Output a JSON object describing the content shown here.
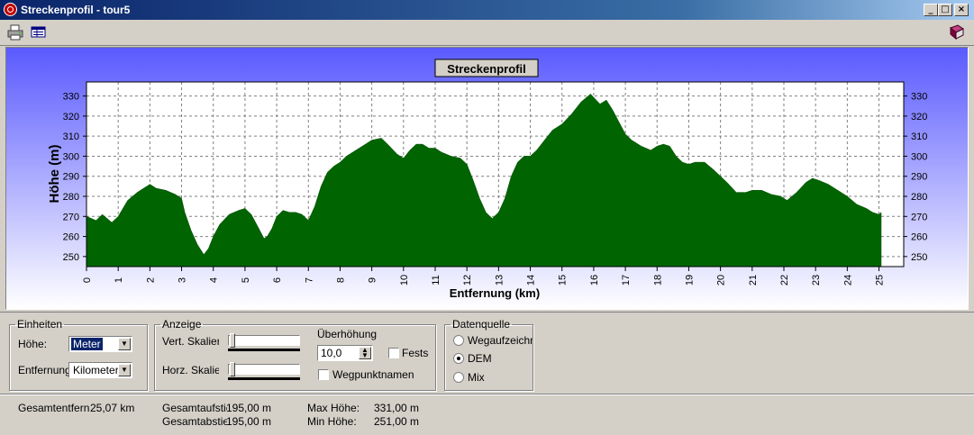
{
  "window": {
    "title": "Streckenprofil - tour5",
    "controls": {
      "minimize": "_",
      "maximize": "□",
      "close": "×"
    }
  },
  "toolbar": {
    "icons": [
      "print-icon",
      "table-icon",
      "help-book-icon"
    ]
  },
  "chart_data": {
    "type": "area",
    "title": "Streckenprofil",
    "xlabel": "Entfernung (km)",
    "ylabel": "Höhe (m)",
    "xlim": [
      0,
      25.07
    ],
    "ylim": [
      245,
      337
    ],
    "x_ticks": [
      0,
      1,
      2,
      3,
      4,
      5,
      6,
      7,
      8,
      9,
      10,
      11,
      12,
      13,
      14,
      15,
      16,
      17,
      18,
      19,
      20,
      21,
      22,
      23,
      24,
      25
    ],
    "y_ticks": [
      250,
      260,
      270,
      280,
      290,
      300,
      310,
      320,
      330
    ],
    "grid": true,
    "fill_color": "#006400",
    "background_gradient": [
      "#5a5aff",
      "#ffffff"
    ],
    "series": [
      {
        "x": [
          0,
          0.3,
          0.5,
          0.8,
          1.0,
          1.3,
          1.6,
          1.9,
          2.0,
          2.2,
          2.5,
          2.8,
          3.0,
          3.1,
          3.3,
          3.5,
          3.7,
          3.85,
          4.0,
          4.2,
          4.5,
          4.8,
          5.0,
          5.2,
          5.4,
          5.6,
          5.7,
          5.85,
          6.0,
          6.2,
          6.4,
          6.6,
          6.8,
          7.0,
          7.2,
          7.4,
          7.6,
          7.8,
          8.0,
          8.2,
          8.5,
          8.8,
          9.0,
          9.3,
          9.5,
          9.8,
          10.0,
          10.2,
          10.4,
          10.6,
          10.8,
          11.0,
          11.2,
          11.5,
          11.8,
          12.0,
          12.2,
          12.4,
          12.6,
          12.8,
          13.0,
          13.2,
          13.4,
          13.6,
          13.8,
          14.0,
          14.2,
          14.5,
          14.7,
          15.0,
          15.3,
          15.6,
          15.9,
          16.2,
          16.4,
          16.6,
          16.8,
          17.0,
          17.2,
          17.5,
          17.8,
          18.0,
          18.2,
          18.4,
          18.6,
          18.8,
          19.0,
          19.2,
          19.5,
          19.8,
          20.0,
          20.2,
          20.5,
          20.8,
          21.0,
          21.3,
          21.6,
          21.9,
          22.1,
          22.4,
          22.7,
          22.9,
          23.1,
          23.4,
          23.7,
          24.0,
          24.3,
          24.6,
          24.8,
          25.0,
          25.07
        ],
        "y": [
          270,
          268,
          271,
          267,
          270,
          278,
          282,
          285,
          286,
          284,
          283,
          281,
          279,
          272,
          263,
          256,
          251,
          254,
          260,
          266,
          271,
          273,
          274,
          271,
          265,
          259,
          260,
          264,
          270,
          273,
          272,
          272,
          271,
          268,
          275,
          285,
          292,
          295,
          297,
          300,
          303,
          306,
          308,
          309,
          306,
          301,
          299,
          303,
          306,
          306,
          304,
          304,
          302,
          300,
          299,
          296,
          288,
          279,
          272,
          269,
          272,
          279,
          290,
          297,
          300,
          300,
          303,
          309,
          313,
          316,
          321,
          327,
          331,
          326,
          328,
          323,
          317,
          311,
          308,
          305,
          303,
          305,
          306,
          305,
          300,
          297,
          296,
          297,
          297,
          293,
          290,
          287,
          282,
          282,
          283,
          283,
          281,
          280,
          278,
          282,
          287,
          289,
          288,
          286,
          283,
          280,
          276,
          274,
          272,
          271,
          272
        ]
      }
    ]
  },
  "panels": {
    "einheiten": {
      "legend": "Einheiten",
      "hoehe_label": "Höhe:",
      "hoehe_value": "Meter",
      "entfernung_label": "Entfernung:",
      "entfernung_value": "Kilometer"
    },
    "anzeige": {
      "legend": "Anzeige",
      "vert_label": "Vert. Skalierung",
      "horz_label": "Horz. Skalierung",
      "ueberhoehung_label": "Überhöhung",
      "ueberhoehung_value": "10,0",
      "festsetzen_label": "Festsetzen",
      "wegpunktnamen_label": "Wegpunktnamen"
    },
    "datenquelle": {
      "legend": "Datenquelle",
      "options": [
        "Wegaufzeichnung",
        "DEM",
        "Mix"
      ],
      "selected": "DEM"
    }
  },
  "status": {
    "gesamtentfernung_label": "Gesamtentfernung:",
    "gesamtentfernung_value": "25,07 km",
    "gesamtaufstieg_label": "Gesamtaufstieg:",
    "gesamtaufstieg_value": "195,00 m",
    "gesamtabstieg_label": "Gesamtabstieg:",
    "gesamtabstieg_value": "195,00 m",
    "max_hoehe_label": "Max Höhe:",
    "max_hoehe_value": "331,00 m",
    "min_hoehe_label": "Min Höhe:",
    "min_hoehe_value": "251,00 m"
  }
}
